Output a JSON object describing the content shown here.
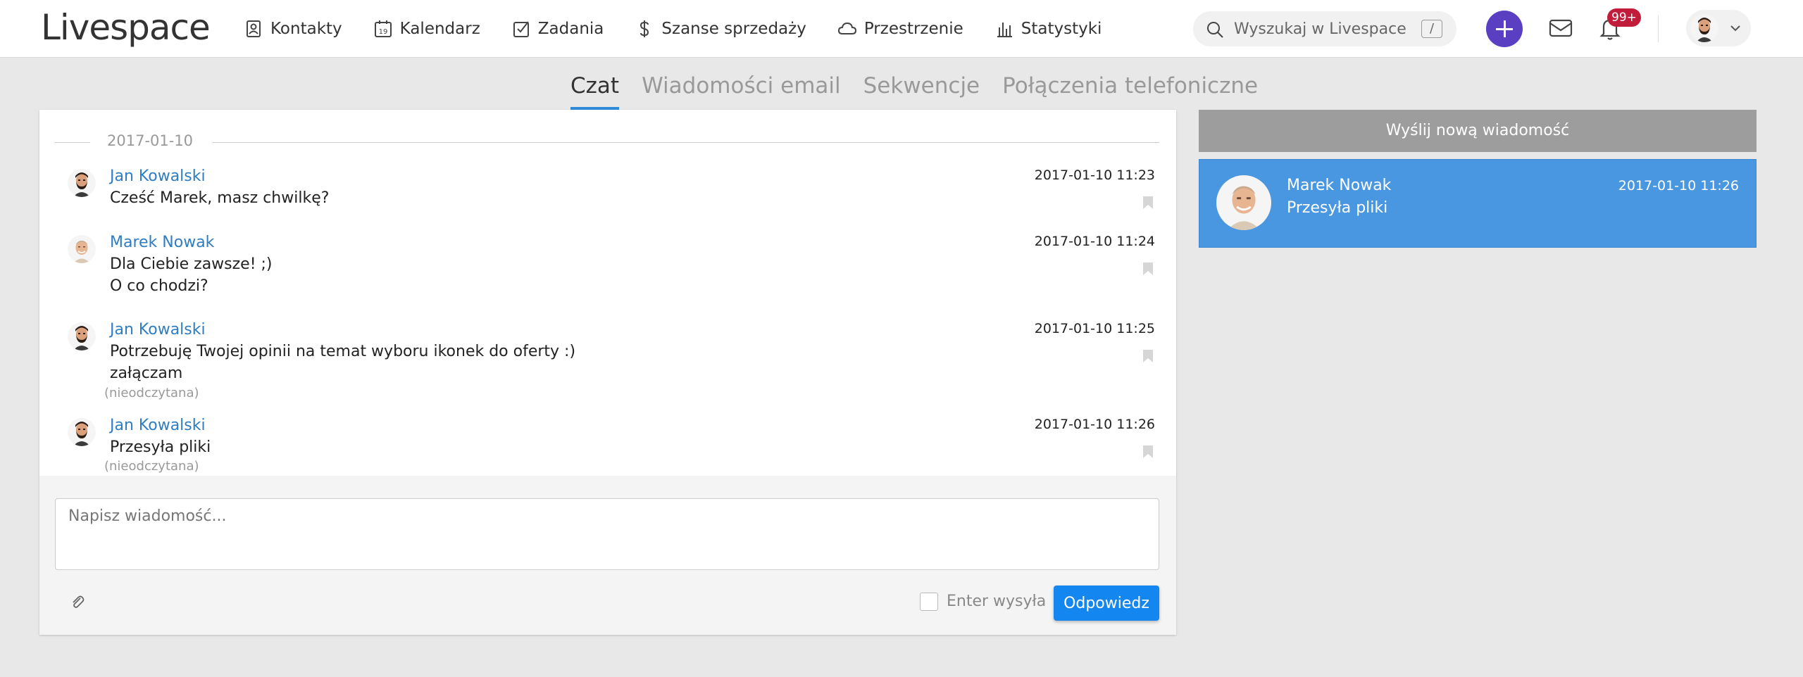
{
  "brand": {
    "logo": "Livespace"
  },
  "nav": [
    {
      "label": "Kontakty",
      "icon": "contact-card-icon"
    },
    {
      "label": "Kalendarz",
      "icon": "calendar-icon"
    },
    {
      "label": "Zadania",
      "icon": "checkbox-icon"
    },
    {
      "label": "Szanse sprzedaży",
      "icon": "dollar-icon"
    },
    {
      "label": "Przestrzenie",
      "icon": "cloud-icon"
    },
    {
      "label": "Statystyki",
      "icon": "bar-chart-icon"
    }
  ],
  "calendar_day": "19",
  "search": {
    "placeholder": "Wyszukaj w Livespace",
    "shortcut": "/"
  },
  "notifications": {
    "count": "99+"
  },
  "tabs": [
    {
      "label": "Czat",
      "active": true
    },
    {
      "label": "Wiadomości email",
      "active": false
    },
    {
      "label": "Sekwencje",
      "active": false
    },
    {
      "label": "Połączenia telefoniczne",
      "active": false
    }
  ],
  "chat": {
    "date": "2017-01-10",
    "messages": [
      {
        "author": "Jan Kowalski",
        "time": "2017-01-10 11:23",
        "lines": [
          "Cześć Marek, masz chwilkę?"
        ],
        "status": ""
      },
      {
        "author": "Marek Nowak",
        "time": "2017-01-10 11:24",
        "lines": [
          "Dla Ciebie zawsze! ;)",
          "O co chodzi?"
        ],
        "status": ""
      },
      {
        "author": "Jan Kowalski",
        "time": "2017-01-10 11:25",
        "lines": [
          "Potrzebuję Twojej opinii na temat wyboru ikonek do oferty :)",
          "załączam"
        ],
        "status": "(nieodczytana)"
      },
      {
        "author": "Jan Kowalski",
        "time": "2017-01-10 11:26",
        "lines": [
          "Przesyła pliki"
        ],
        "status": "(nieodczytana)"
      }
    ],
    "compose": {
      "placeholder": "Napisz wiadomość...",
      "enter_label": "Enter wysyła",
      "reply_label": "Odpowiedz"
    }
  },
  "sidebar": {
    "new_message_label": "Wyślij nową wiadomość",
    "conversation": {
      "name": "Marek Nowak",
      "preview": "Przesyła pliki",
      "time": "2017-01-10 11:26"
    }
  },
  "colors": {
    "accent": "#1486ef",
    "link": "#2f7dc2",
    "plus": "#5b3fc2",
    "badge": "#c21c3b",
    "selected": "#4a97e1"
  }
}
